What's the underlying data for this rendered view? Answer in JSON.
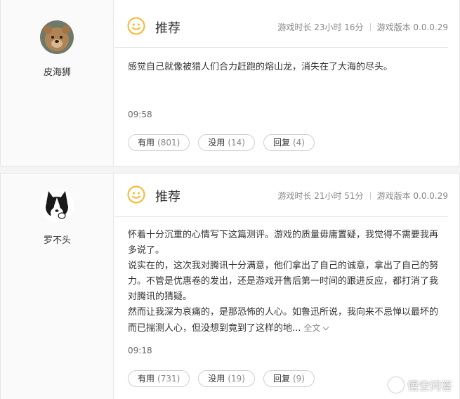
{
  "reviews": [
    {
      "username": "皮海狮",
      "avatar_icon": "teddy-bear-avatar",
      "verdict": "推荐",
      "playtime": "游戏时长 23小时 16分",
      "version": "游戏版本 0.0.0.29",
      "content": "感觉自己就像被猎人们合力赶跑的熔山龙，消失在了大海的尽头。",
      "time": "09:58",
      "useful": {
        "label": "有用",
        "count": "(801)"
      },
      "useless": {
        "label": "没用",
        "count": "(14)"
      },
      "reply": {
        "label": "回复",
        "count": "(4)"
      }
    },
    {
      "username": "罗不头",
      "avatar_icon": "husky-avatar",
      "verdict": "推荐",
      "playtime": "游戏时长 21小时 51分",
      "version": "游戏版本 0.0.0.29",
      "content": "怀着十分沉重的心情写下这篇测评。游戏的质量毋庸置疑，我觉得不需要我再多说了。\n说实在的，这次我对腾讯十分满意，他们拿出了自己的诚意，拿出了自己的努力。不管是优惠卷的发出，还是游戏开售后第一时间的跟进反应，都打消了我对腾讯的猜疑。\n然而让我深为哀痛的，是那恐怖的人心。如鲁迅所说，我向来不忌惮以最坏的而已揣测人心，但没想到竟到了这样的地...",
      "more": "全文",
      "time": "09:18",
      "useful": {
        "label": "有用",
        "count": "(731)"
      },
      "useless": {
        "label": "没用",
        "count": "(19)"
      },
      "reply": {
        "label": "回复",
        "count": "(9)"
      }
    }
  ],
  "watermark": "悟空问答",
  "colors": {
    "smile": "#f5b82e",
    "border": "#e6e6e6",
    "muted": "#888888"
  }
}
